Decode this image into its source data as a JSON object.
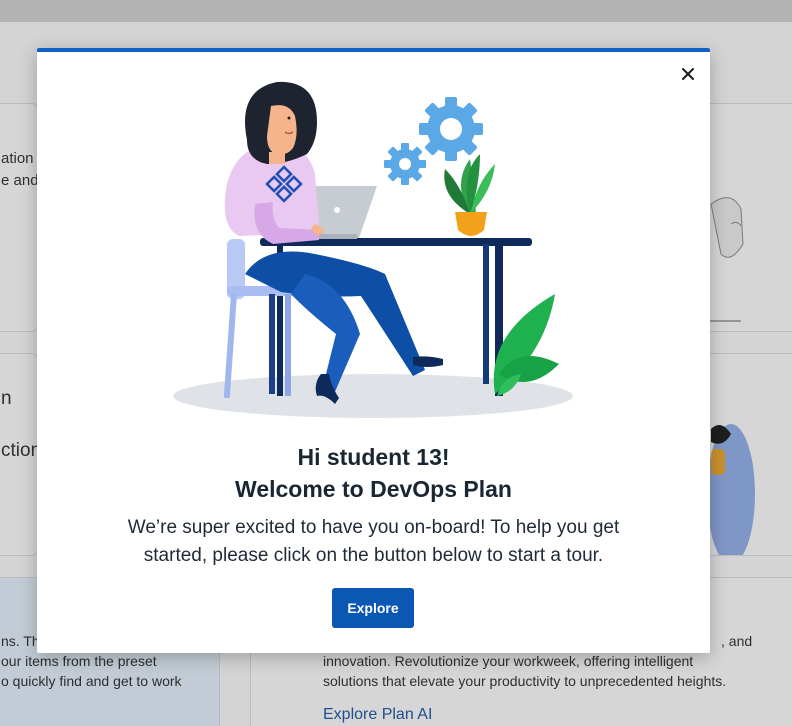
{
  "background": {
    "card1_lines": [
      "ation",
      "e and"
    ],
    "card2_title": "n",
    "card2_line": "ction",
    "card3_lines": [
      "ns. Th",
      "our items from the preset",
      "o quickly find and get to work"
    ],
    "card4_lines": [
      ", and",
      "innovation. Revolutionize your workweek, offering intelligent",
      "solutions that elevate your productivity to unprecedented heights."
    ],
    "card4_link": "Explore Plan AI"
  },
  "modal": {
    "greeting": "Hi student 13!",
    "welcome": "Welcome to DevOps Plan",
    "message": "We’re super excited to have you on-board! To help you get started, please click on the button below to start a tour.",
    "explore_label": "Explore",
    "close_icon": "close-icon"
  },
  "colors": {
    "accent": "#0f62c5",
    "button": "#0b58b4"
  }
}
